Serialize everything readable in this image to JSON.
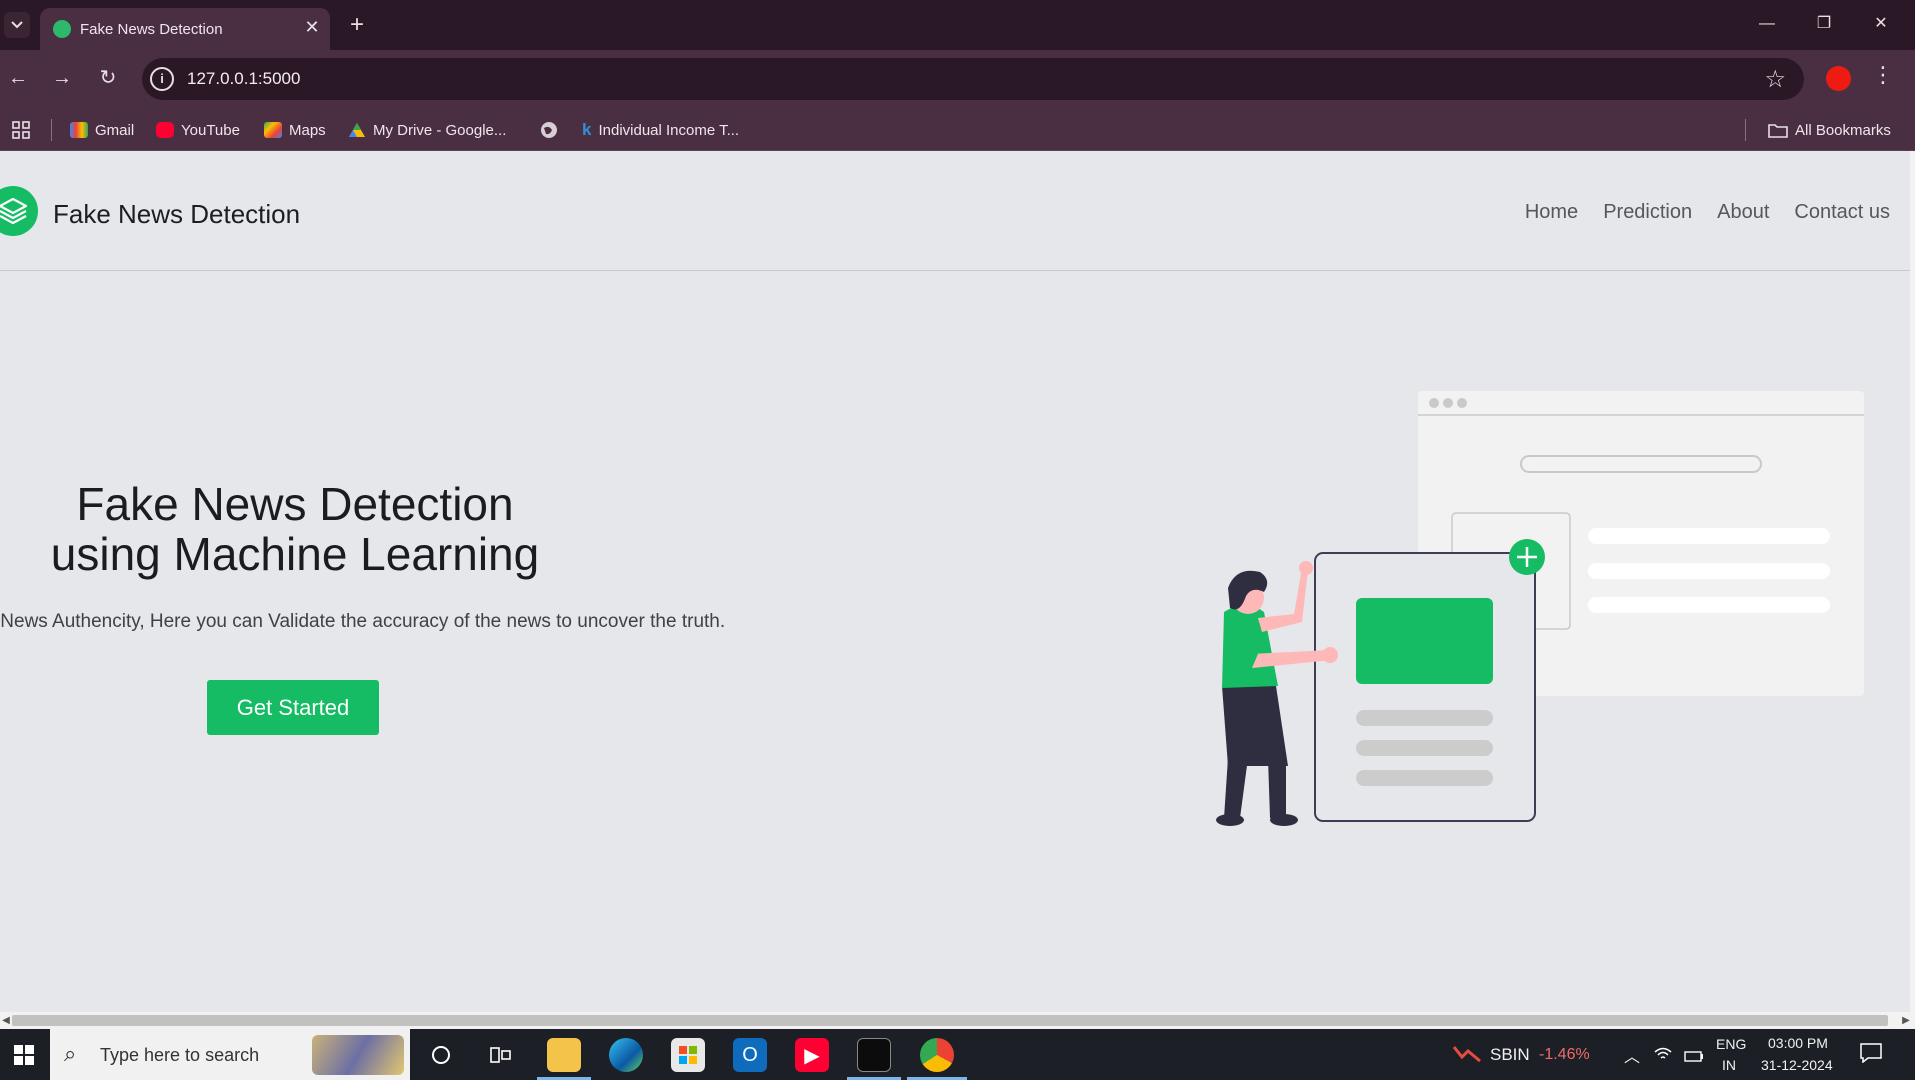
{
  "browser": {
    "tab_title": "Fake News Detection",
    "url": "127.0.0.1:5000",
    "bookmarks": [
      {
        "label": "Gmail",
        "icon": "gmail-icon"
      },
      {
        "label": "YouTube",
        "icon": "youtube-icon"
      },
      {
        "label": "Maps",
        "icon": "maps-icon"
      },
      {
        "label": "My Drive - Google...",
        "icon": "drive-icon"
      },
      {
        "label": "",
        "icon": "globe-icon"
      },
      {
        "label": "Individual Income T...",
        "icon": "income-tax-icon"
      }
    ],
    "all_bookmarks": "All Bookmarks",
    "accent": "#4a2f42"
  },
  "site": {
    "brand": "Fake News Detection",
    "nav": [
      "Home",
      "Prediction",
      "About",
      "Contact us"
    ],
    "hero_title_line1": "Fake News Detection",
    "hero_title_line2": "using Machine Learning",
    "hero_subtitle": "able Source for Verifying News Authencity, Here you can Validate the accuracy of the news to uncover the truth.",
    "cta": "Get Started",
    "accent": "#15bc63"
  },
  "taskbar": {
    "search_placeholder": "Type here to search",
    "stock_symbol": "SBIN",
    "stock_change": "-1.46%",
    "lang_top": "ENG",
    "lang_bottom": "IN",
    "time": "03:00 PM",
    "date": "31-12-2024"
  }
}
